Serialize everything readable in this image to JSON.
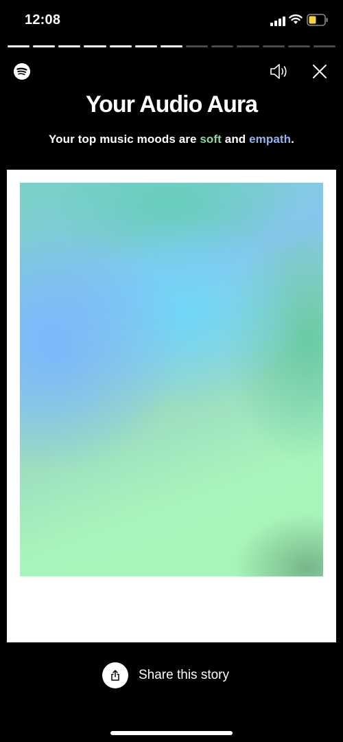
{
  "status_bar": {
    "time": "12:08"
  },
  "progress": {
    "total_segments": 13,
    "completed_segments": 7
  },
  "icons": {
    "app": "spotify-icon",
    "sound": "speaker-icon",
    "close": "close-icon",
    "share": "share-icon"
  },
  "story": {
    "title": "Your Audio Aura",
    "subtitle_prefix": "Your top music moods are ",
    "mood_1": "soft",
    "subtitle_middle": " and ",
    "mood_2": "empath",
    "subtitle_suffix": "."
  },
  "share": {
    "label": "Share this story"
  },
  "colors": {
    "background": "#000000",
    "mood_soft": "#8bd8a6",
    "mood_empath": "#8fb6ee",
    "aura_green": "#a8f5b8",
    "aura_blue": "#6fd0f7"
  }
}
